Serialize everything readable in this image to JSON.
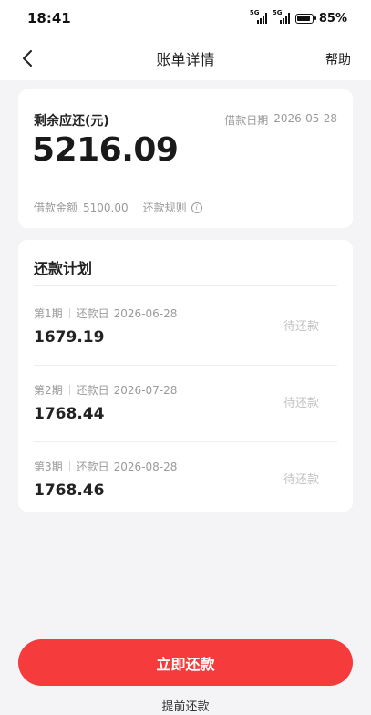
{
  "status_bar": {
    "time": "18:41",
    "network_1": "5G",
    "network_2": "5G",
    "battery_percent": "85%"
  },
  "nav": {
    "title": "账单详情",
    "help_label": "帮助"
  },
  "summary": {
    "remaining_label": "剩余应还(元)",
    "loan_date_label": "借款日期",
    "loan_date_value": "2026-05-28",
    "remaining_amount": "5216.09",
    "loan_amount_label": "借款金额",
    "loan_amount_value": "5100.00",
    "repay_rules_label": "还款规则"
  },
  "plan": {
    "title": "还款计划",
    "rows": [
      {
        "period": "第1期",
        "due_label": "还款日",
        "due_date": "2026-06-28",
        "amount": "1679.19",
        "status": "待还款"
      },
      {
        "period": "第2期",
        "due_label": "还款日",
        "due_date": "2026-07-28",
        "amount": "1768.44",
        "status": "待还款"
      },
      {
        "period": "第3期",
        "due_label": "还款日",
        "due_date": "2026-08-28",
        "amount": "1768.46",
        "status": "待还款"
      }
    ]
  },
  "actions": {
    "pay_now_label": "立即还款",
    "prepay_label": "提前还款"
  },
  "colors": {
    "primary_red": "#f53b3b",
    "background": "#f4f4f6",
    "muted_text": "#9a9a9a",
    "pending_status": "#c4c4c4"
  }
}
